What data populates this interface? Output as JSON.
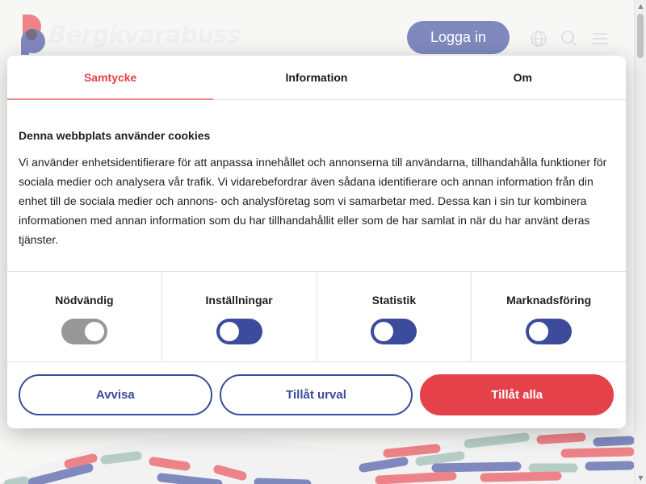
{
  "header": {
    "brand": "Bergkvarabuss",
    "login_label": "Logga in",
    "icons": [
      "globe-icon",
      "search-icon",
      "menu-icon"
    ]
  },
  "colors": {
    "brand_blue": "#3c4b9c",
    "brand_red": "#e4414a",
    "toggle_disabled": "#979797"
  },
  "dialog": {
    "tabs": [
      {
        "label": "Samtycke",
        "active": true
      },
      {
        "label": "Information",
        "active": false
      },
      {
        "label": "Om",
        "active": false
      }
    ],
    "heading": "Denna webbplats använder cookies",
    "body": "Vi använder enhetsidentifierare för att anpassa innehållet och annonserna till användarna, tillhandahålla funktioner för sociala medier och analysera vår trafik. Vi vidarebefordrar även sådana identifierare och annan information från din enhet till de sociala medier och annons- och analysföretag som vi samarbetar med. Dessa kan i sin tur kombinera informationen med annan information som du har tillhandahållit eller som de har samlat in när du har använt deras tjänster.",
    "toggles": [
      {
        "label": "Nödvändig",
        "on": true,
        "disabled": true
      },
      {
        "label": "Inställningar",
        "on": false,
        "disabled": false
      },
      {
        "label": "Statistik",
        "on": false,
        "disabled": false
      },
      {
        "label": "Marknadsföring",
        "on": false,
        "disabled": false
      }
    ],
    "buttons": {
      "reject": "Avvisa",
      "allow_selection": "Tillåt urval",
      "allow_all": "Tillåt alla"
    }
  }
}
